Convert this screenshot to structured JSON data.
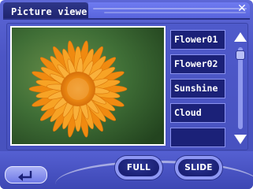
{
  "window": {
    "title": "Picture viewer",
    "close_glyph": "✕"
  },
  "viewer": {
    "image_name": "flower",
    "list": [
      "Flower01",
      "Flower02",
      "Sunshine",
      "Cloud",
      ""
    ]
  },
  "controls": {
    "back_glyph": "back-arrow-icon",
    "full_label": "FULL",
    "slide_label": "SLIDE"
  },
  "scroll": {
    "position": 0.05
  },
  "colors": {
    "frame": "#4c55c5",
    "list_bg": "#1b2178",
    "list_border": "#8c93ef",
    "petal": "#f39a1a",
    "leaf_bg": "#3f6e36"
  }
}
